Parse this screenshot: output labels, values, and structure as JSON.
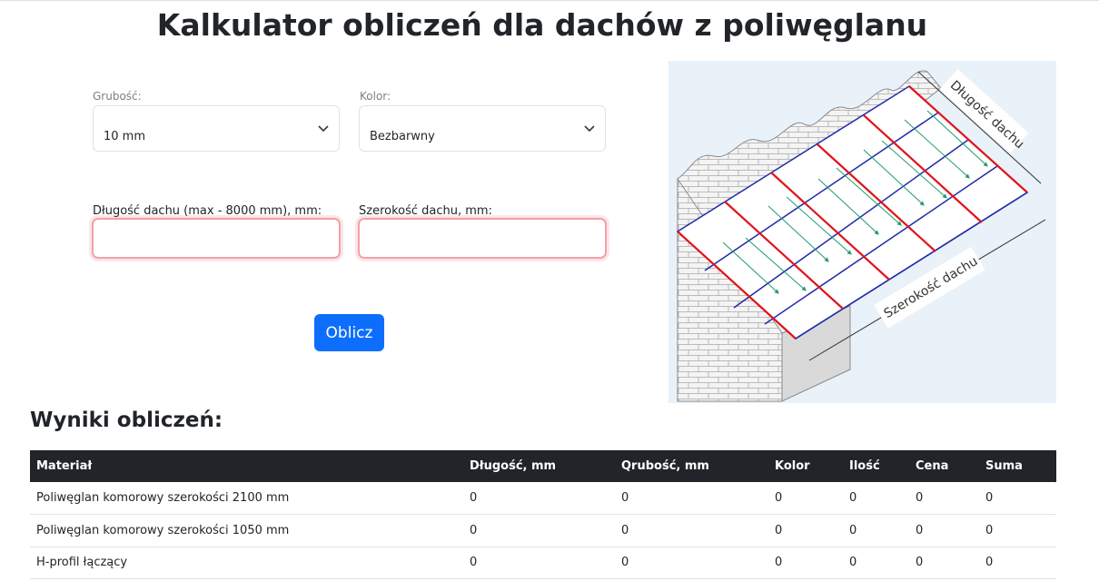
{
  "page": {
    "title": "Kalkulator obliczeń dla dachów z poliwęglanu"
  },
  "form": {
    "thickness": {
      "label": "Grubość:",
      "value": "10 mm"
    },
    "color": {
      "label": "Kolor:",
      "value": "Bezbarwny"
    },
    "length": {
      "label": "Długość dachu (max - 8000 mm), mm:",
      "value": ""
    },
    "width": {
      "label": "Szerokość dachu, mm:",
      "value": ""
    },
    "submit_label": "Oblicz"
  },
  "diagram": {
    "length_label": "Długość dachu",
    "width_label": "Szerokość dachu"
  },
  "results": {
    "title": "Wyniki obliczeń:",
    "columns": [
      "Materiał",
      "Długość, mm",
      "Qrubość, mm",
      "Kolor",
      "Ilość",
      "Cena",
      "Suma"
    ],
    "rows": [
      [
        "Poliwęglan komorowy szerokości 2100 mm",
        "0",
        "0",
        "0",
        "0",
        "0",
        "0"
      ],
      [
        "Poliwęglan komorowy szerokości 1050 mm",
        "0",
        "0",
        "0",
        "0",
        "0",
        "0"
      ],
      [
        "H-profil łączący",
        "0",
        "0",
        "0",
        "0",
        "0",
        "0"
      ]
    ]
  },
  "colors": {
    "primary": "#0d6efd",
    "header_bg": "#212529",
    "invalid_border": "#f3a0a6",
    "diagram_bg": "#e9f1f9",
    "panel_red": "#e0141c",
    "panel_blue": "#1f2aa6",
    "arrow_green": "#1e9a6e"
  }
}
